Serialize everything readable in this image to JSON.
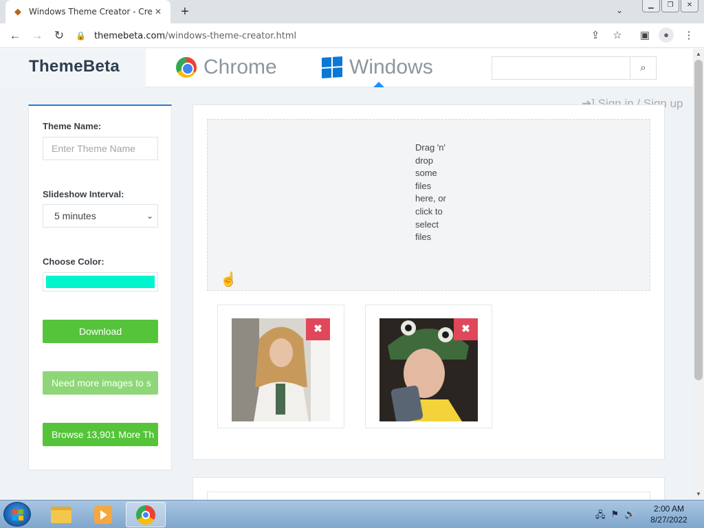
{
  "browser": {
    "tab_title": "Windows Theme Creator - Create",
    "new_tab": "+",
    "url_host": "themebeta.com",
    "url_path": "/windows-theme-creator.html"
  },
  "site": {
    "logo": "ThemeBeta",
    "nav": [
      {
        "label": "Chrome",
        "icon": "chrome-logo-icon"
      },
      {
        "label": "Windows",
        "icon": "windows-logo-icon",
        "active": true
      }
    ],
    "search_placeholder": "",
    "signin": "Sign in / Sign up"
  },
  "sidebar": {
    "theme_name_label": "Theme Name:",
    "theme_name_placeholder": "Enter Theme Name",
    "slideshow_label": "Slideshow Interval:",
    "slideshow_value": "5 minutes",
    "color_label": "Choose Color:",
    "color_value": "#00f5cf",
    "download": "Download",
    "more_images": "Need more images to s",
    "browse_more": "Browse 13,901 More Th"
  },
  "dropzone": {
    "text": "Drag 'n' drop some files here, or click to select files"
  },
  "colors": {
    "accent_blue": "#2a7ac8",
    "green": "#55c43a",
    "delete_red": "#e0475b"
  },
  "taskbar": {
    "time": "2:00 AM",
    "date": "8/27/2022"
  }
}
